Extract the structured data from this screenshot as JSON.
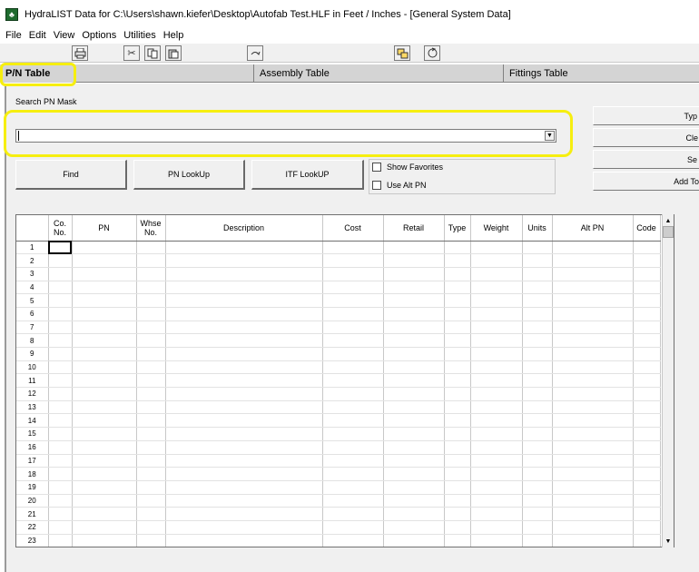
{
  "window": {
    "title": "HydraLIST Data for C:\\Users\\shawn.kiefer\\Desktop\\Autofab Test.HLF in Feet / Inches - [General System Data]"
  },
  "menu": [
    "File",
    "Edit",
    "View",
    "Options",
    "Utilities",
    "Help"
  ],
  "toolbar": {
    "icons": [
      "print-icon",
      "cut-icon",
      "copy-icon",
      "paste-icon",
      "undo-icon",
      "window-icon",
      "refresh-icon"
    ]
  },
  "tabs": [
    {
      "label": "P/N Table",
      "active": true
    },
    {
      "label": "Assembly Table",
      "active": false
    },
    {
      "label": "Fittings Table",
      "active": false
    }
  ],
  "search": {
    "label": "Search PN Mask",
    "value": ""
  },
  "buttons": {
    "find": "Find",
    "pn_lookup": "PN LookUp",
    "itf_lookup": "ITF LookUP"
  },
  "options": {
    "show_favorites": "Show Favorites",
    "use_alt_pn": "Use Alt PN"
  },
  "right_buttons": [
    "Typ",
    "Cle",
    "Se",
    "Add To"
  ],
  "grid": {
    "columns": [
      "",
      "Co.\nNo.",
      "PN",
      "Whse\nNo.",
      "Description",
      "Cost",
      "Retail",
      "Type",
      "Weight",
      "Units",
      "Alt PN",
      "Code"
    ],
    "row_numbers": [
      "1",
      "2",
      "3",
      "4",
      "5",
      "6",
      "7",
      "8",
      "9",
      "10",
      "11",
      "12",
      "13",
      "14",
      "15",
      "16",
      "17",
      "18",
      "19",
      "20",
      "21",
      "22",
      "23"
    ]
  },
  "highlight_color": "#f6ee10"
}
